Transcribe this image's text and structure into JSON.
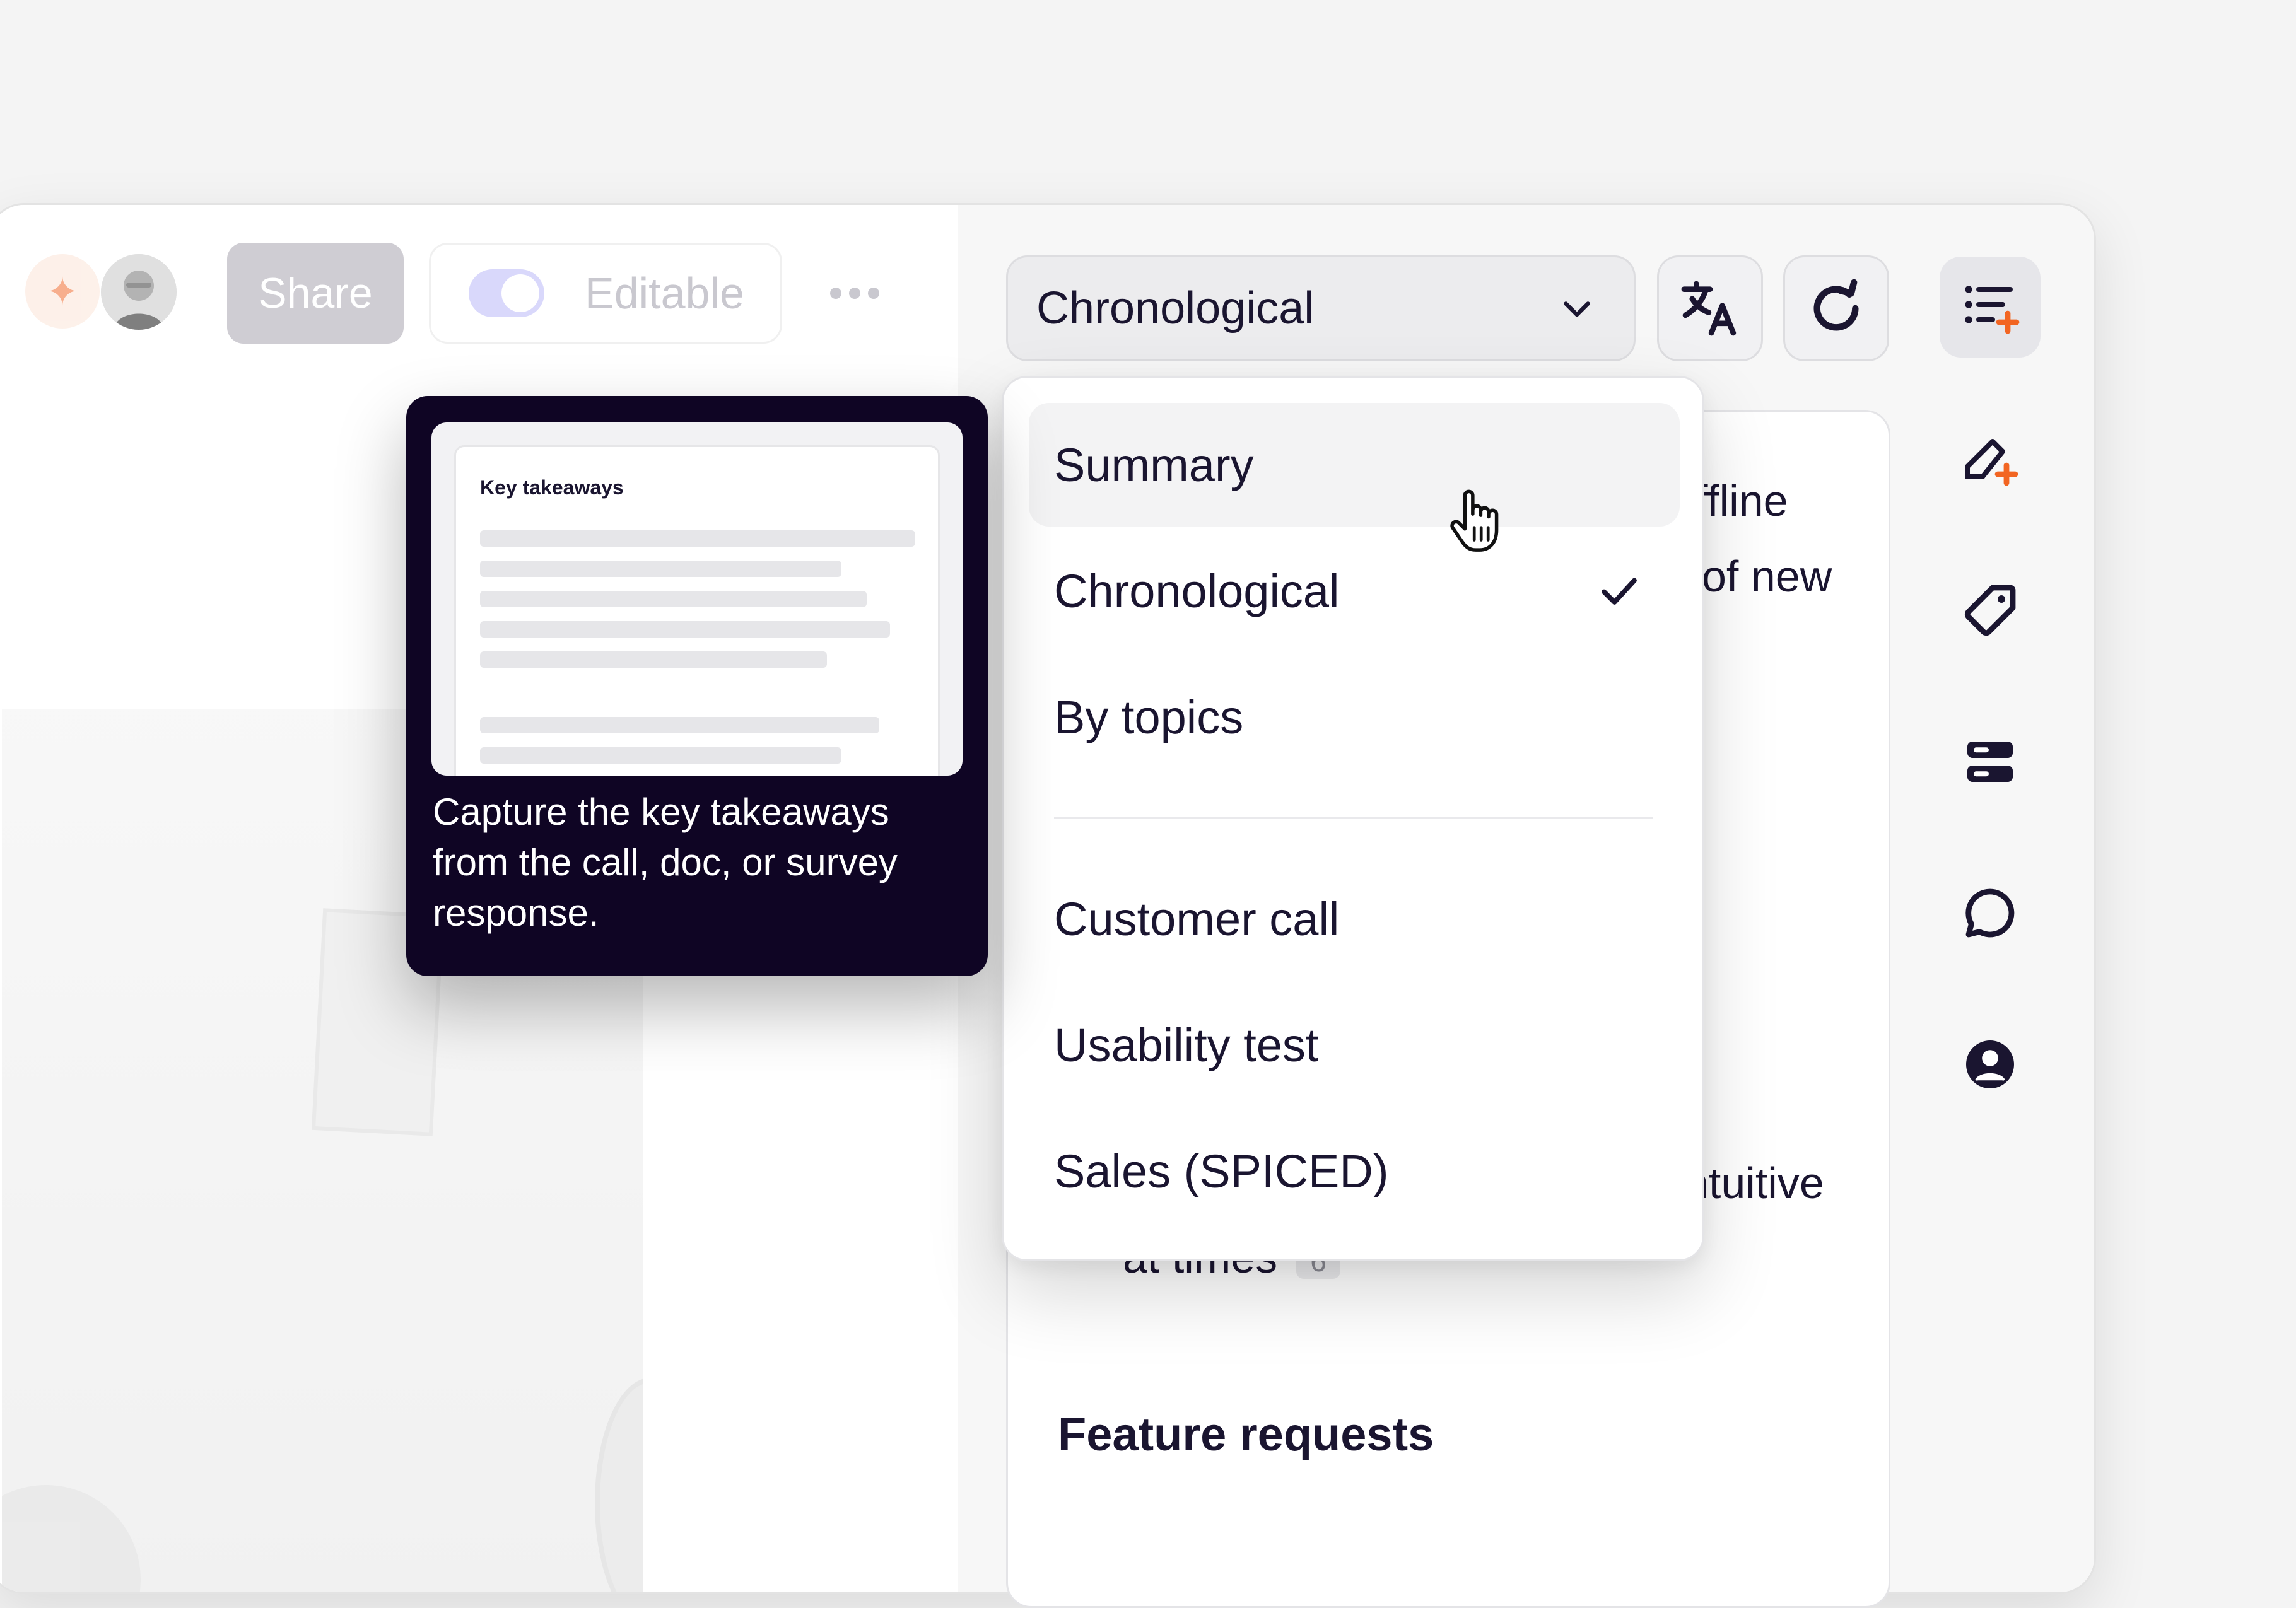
{
  "header": {
    "share_label": "Share",
    "editable_label": "Editable",
    "editable_on": true
  },
  "view_selector": {
    "selected": "Chronological"
  },
  "menu": {
    "items": [
      {
        "label": "Summary",
        "hovered": true,
        "checked": false
      },
      {
        "label": "Chronological",
        "hovered": false,
        "checked": true
      },
      {
        "label": "By topics",
        "hovered": false,
        "checked": false
      },
      {
        "label": "Customer call",
        "hovered": false,
        "checked": false
      },
      {
        "label": "Usability test",
        "hovered": false,
        "checked": false
      },
      {
        "label": "Sales (SPICED)",
        "hovered": false,
        "checked": false
      }
    ]
  },
  "tooltip": {
    "preview_title": "Key takeaways",
    "description": "Capture the key takeaways from the call, doc, or survey response."
  },
  "document": {
    "fragments": [
      "ffline",
      "of new",
      "ntuitive",
      "at times"
    ],
    "fragment_count": "6",
    "heading": "Feature requests"
  },
  "icons": {
    "translate": "translate-icon",
    "regenerate": "regenerate-icon",
    "rail": [
      "list-add-icon",
      "edit-add-icon",
      "tag-icon",
      "layout-icon",
      "comment-icon",
      "user-icon"
    ]
  },
  "colors": {
    "accent": "#f26522",
    "tooltip_bg": "#0f0524",
    "text": "#1a1530",
    "toggle": "#d9d8fb"
  }
}
